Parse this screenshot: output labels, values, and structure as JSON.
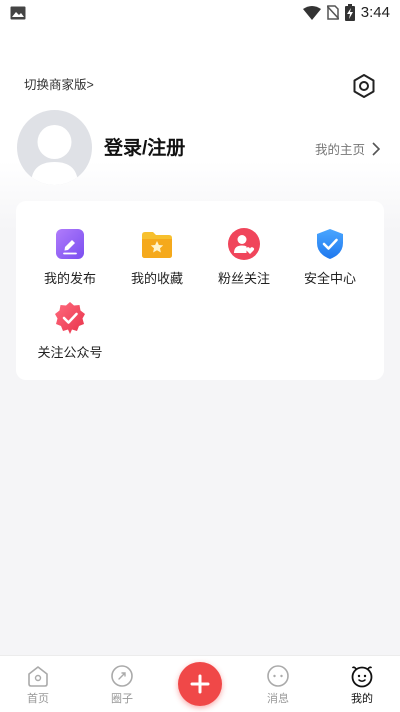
{
  "status_bar": {
    "time": "3:44"
  },
  "header": {
    "switch_merchant": "切换商家版>",
    "login_register": "登录/注册",
    "my_homepage": "我的主页"
  },
  "menu": {
    "items": [
      {
        "label": "我的发布",
        "icon": "edit-doc-icon",
        "color": "#8a5cf6"
      },
      {
        "label": "我的收藏",
        "icon": "star-folder-icon",
        "color": "#f5b321"
      },
      {
        "label": "粉丝关注",
        "icon": "user-heart-icon",
        "color": "#f0455b"
      },
      {
        "label": "安全中心",
        "icon": "shield-check-icon",
        "color": "#2f8cf5"
      },
      {
        "label": "关注公众号",
        "icon": "badge-check-icon",
        "color": "#f0455b"
      }
    ]
  },
  "bottom_nav": {
    "items": [
      {
        "label": "首页",
        "icon": "home-icon"
      },
      {
        "label": "圈子",
        "icon": "circle-icon"
      },
      {
        "label": "消息",
        "icon": "message-icon"
      },
      {
        "label": "我的",
        "icon": "profile-face-icon",
        "active": true
      }
    ],
    "fab_icon": "plus-icon"
  },
  "colors": {
    "accent": "#f04848",
    "background": "#f5f5f7"
  }
}
